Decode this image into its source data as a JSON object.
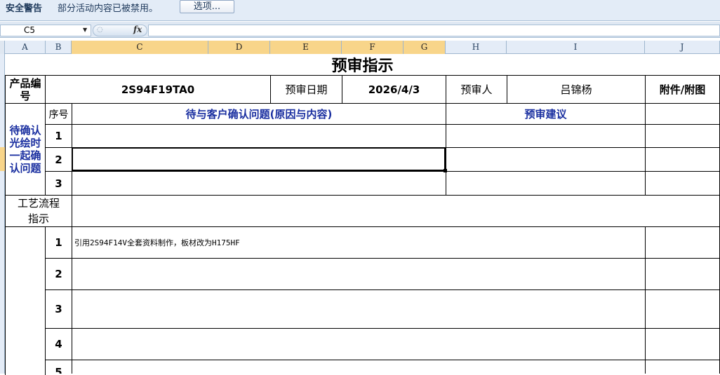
{
  "security_bar": {
    "title": "安全警告",
    "message": "部分活动内容已被禁用。",
    "options_button": "选项..."
  },
  "formula_bar": {
    "name_box": "C5",
    "fx_label": "fx",
    "value": ""
  },
  "columns": [
    "A",
    "B",
    "C",
    "D",
    "E",
    "F",
    "G",
    "H",
    "I",
    "J"
  ],
  "sheet": {
    "title": "预审指示",
    "product_no_label": "产品编号",
    "product_no": "2S94F19TA0",
    "review_date_label": "预审日期",
    "review_date": "2026/4/3",
    "reviewer_label": "预审人",
    "reviewer": "吕锦杨",
    "attachment_label": "附件/附图",
    "seq_label": "序号",
    "pending_issue_header": "待与客户确认问题(原因与内容)",
    "suggestion_header": "预审建议",
    "section_confirm": "待确认光绘时一起确认问题",
    "confirm_rows": [
      "1",
      "2",
      "3"
    ],
    "section_process": "工艺流程指示",
    "process_rows": [
      {
        "no": "1",
        "text": "引用2S94F14V全套资料制作，板材改为H175HF"
      },
      {
        "no": "2",
        "text": ""
      },
      {
        "no": "3",
        "text": ""
      },
      {
        "no": "4",
        "text": ""
      },
      {
        "no": "5",
        "text": ""
      }
    ]
  }
}
